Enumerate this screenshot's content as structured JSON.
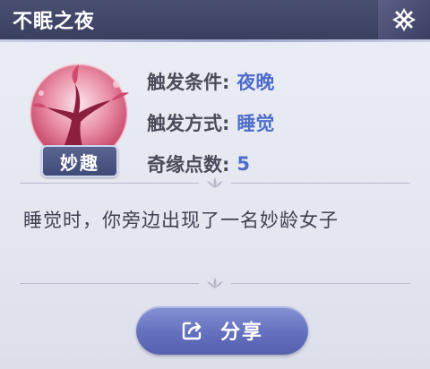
{
  "dialog": {
    "title": "不眠之夜",
    "badge": "妙趣",
    "info": [
      {
        "label": "触发条件:",
        "value": "夜晚"
      },
      {
        "label": "触发方式:",
        "value": "睡觉"
      },
      {
        "label": "奇缘点数:",
        "value": "5"
      }
    ],
    "description": "睡觉时，你旁边出现了一名妙龄女子",
    "share_label": "分享"
  },
  "icons": {
    "close": "close-icon",
    "share": "share-icon",
    "medallion": "tree-medallion-icon"
  },
  "colors": {
    "header": "#3f4466",
    "value_accent": "#4e6dc9",
    "button": "#6370be",
    "medallion": "#d85a7a"
  }
}
